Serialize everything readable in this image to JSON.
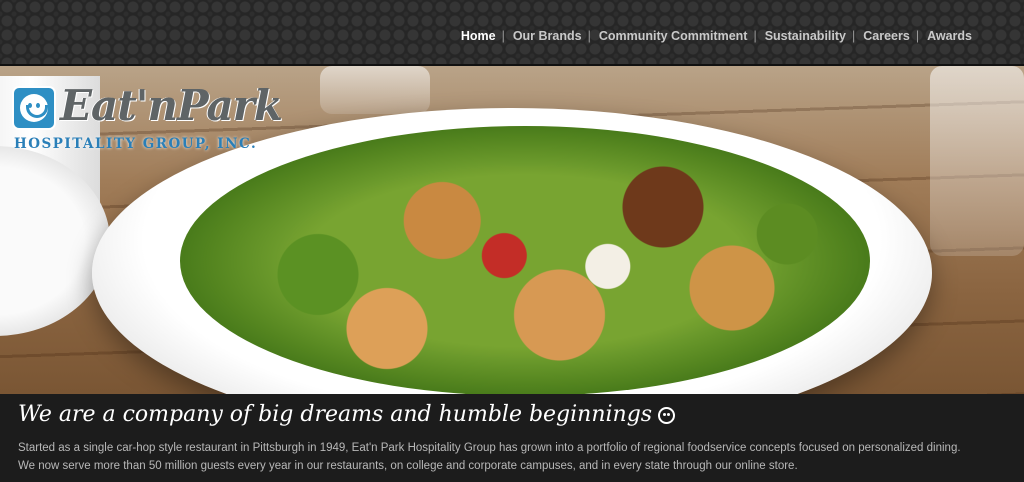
{
  "nav": {
    "items": [
      {
        "label": "Home",
        "active": true
      },
      {
        "label": "Our Brands",
        "active": false
      },
      {
        "label": "Community Commitment",
        "active": false
      },
      {
        "label": "Sustainability",
        "active": false
      },
      {
        "label": "Careers",
        "active": false
      },
      {
        "label": "Awards",
        "active": false
      }
    ],
    "separator": "|"
  },
  "logo": {
    "wordmark": "Eat'nPark",
    "subtitle": "HOSPITALITY GROUP, INC."
  },
  "hero": {
    "image": "salad-bowl-photo"
  },
  "caption": {
    "headline": "We are a company of big dreams and humble beginnings",
    "line1": "Started as a single car-hop style restaurant in Pittsburgh in 1949, Eat'n Park Hospitality Group has grown into a portfolio of regional foodservice concepts focused on personalized dining.",
    "line2": "We now serve more than 50 million guests every year in our restaurants, on college and corporate campuses, and in every state through our online store."
  },
  "colors": {
    "nav_bg": "#262626",
    "logo_blue": "#2a7fb8",
    "caption_bg": "#1c1c1c"
  }
}
